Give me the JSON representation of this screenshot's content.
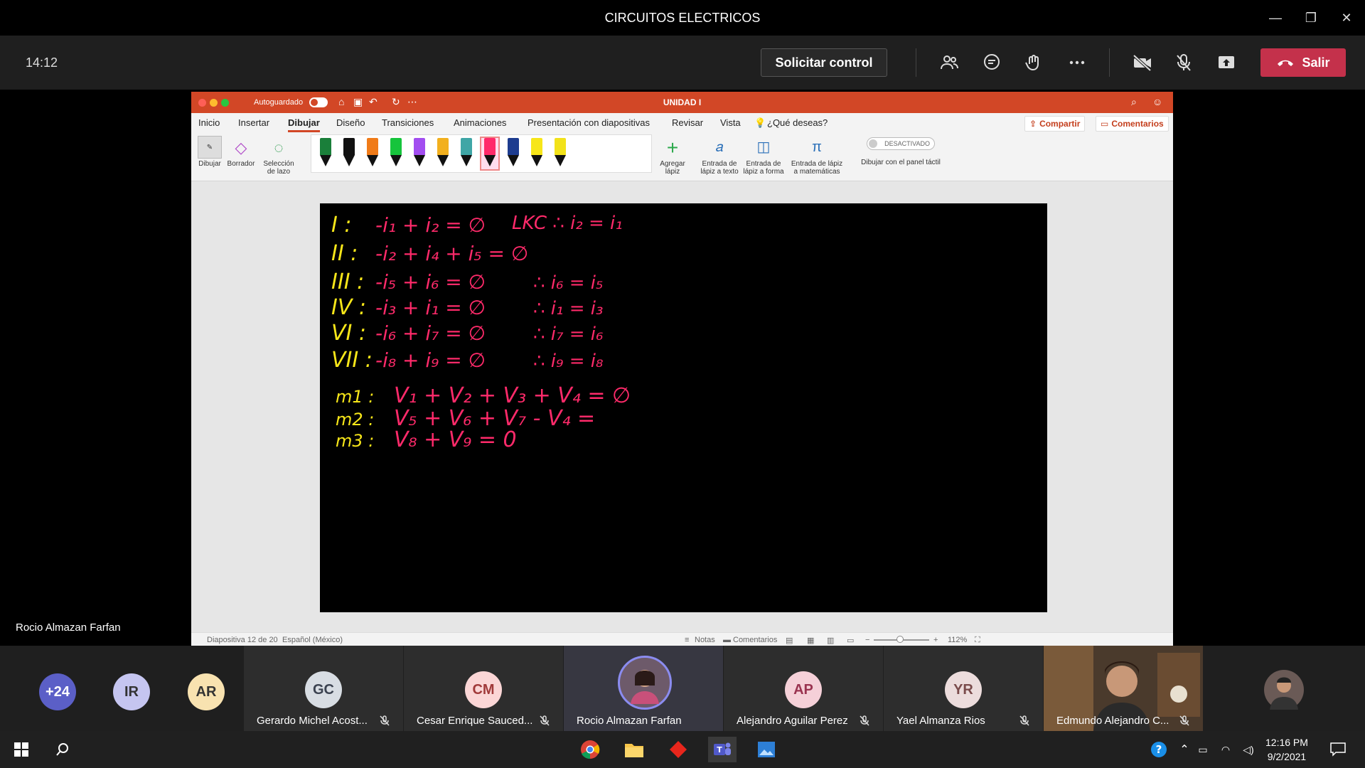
{
  "window": {
    "title": "CIRCUITOS ELECTRICOS"
  },
  "meeting": {
    "timer": "14:12",
    "request_control": "Solicitar control",
    "leave": "Salir",
    "presenter": "Rocio Almazan Farfan"
  },
  "ppt": {
    "autosave": "Autoguardado",
    "doc_title": "UNIDAD I",
    "tabs": [
      "Inicio",
      "Insertar",
      "Dibujar",
      "Diseño",
      "Transiciones",
      "Animaciones",
      "Presentación con diapositivas",
      "Revisar",
      "Vista",
      "¿Qué deseas?"
    ],
    "share": "Compartir",
    "comments": "Comentarios",
    "tools": {
      "draw": "Dibujar",
      "eraser": "Borrador",
      "lasso": "Selección de lazo",
      "add_pen": "Agregar lápiz",
      "ink_text": "Entrada de lápiz a texto",
      "ink_shape": "Entrada de lápiz a forma",
      "ink_math": "Entrada de lápiz a matemáticas",
      "toggle": "DESACTIVADO",
      "touch": "Dibujar con el panel táctil"
    },
    "pen_colors": [
      "#1a7f3a",
      "#111111",
      "#f07b18",
      "#16c43c",
      "#a24ef0",
      "#f2b01e",
      "#3fa6a6",
      "#ff2a6a",
      "#1d3c8f",
      "#f7e619",
      "#f2e21a"
    ],
    "status": {
      "slide": "Diapositiva 12 de 20",
      "language": "Español (México)",
      "notes": "Notas",
      "comments": "Comentarios",
      "zoom": "112%"
    }
  },
  "slide_ink": {
    "rows": [
      {
        "label": "I :",
        "eq": "-i₁ + i₂ = ∅",
        "extra": "LKC  ∴  i₂ = i₁"
      },
      {
        "label": "II :",
        "eq": "-i₂ + i₄ + i₅ = ∅",
        "extra": ""
      },
      {
        "label": "III :",
        "eq": "-i₅ + i₆ = ∅",
        "extra": "∴ i₆ = i₅"
      },
      {
        "label": "IV :",
        "eq": "-i₃ + i₁ = ∅",
        "extra": "∴ i₁ = i₃"
      },
      {
        "label": "VI :",
        "eq": "-i₆ + i₇ = ∅",
        "extra": "∴ i₇ = i₆"
      },
      {
        "label": "VII :",
        "eq": "-i₈ + i₉ = ∅",
        "extra": "∴ i₉ = i₈"
      }
    ],
    "meshes": [
      {
        "label": "m1 :",
        "eq": "V₁ + V₂ + V₃ + V₄ = ∅"
      },
      {
        "label": "m2 :",
        "eq": "V₅ + V₆ + V₇ - V₄ ="
      },
      {
        "label": "m3 :",
        "eq": "V₈ + V₉ = 0"
      }
    ]
  },
  "participants": {
    "more": "+24",
    "small": [
      {
        "initials": "IR",
        "color": "#c5c5f0"
      },
      {
        "initials": "AR",
        "color": "#f8e2b0"
      }
    ],
    "tiles": [
      {
        "initials": "GC",
        "name": "Gerardo Michel Acost...",
        "color": "#d8dde3",
        "fg": "#3b4250"
      },
      {
        "initials": "CM",
        "name": "Cesar Enrique Sauced...",
        "color": "#fbd6d6",
        "fg": "#a13a3a"
      },
      {
        "initials": "",
        "name": "Rocio Almazan Farfan",
        "color": "#6d6d9c",
        "fg": "#fff"
      },
      {
        "initials": "AP",
        "name": "Alejandro Aguilar Perez",
        "color": "#f5d0d8",
        "fg": "#9a3350"
      },
      {
        "initials": "YR",
        "name": "Yael Almanza Rios",
        "color": "#ecdcdc",
        "fg": "#7a4b4b"
      },
      {
        "initials": "",
        "name": "Edmundo Alejandro C...",
        "color": "#5a4a3a",
        "fg": "#fff"
      }
    ]
  },
  "taskbar": {
    "time": "12:16 PM",
    "date": "9/2/2021"
  }
}
